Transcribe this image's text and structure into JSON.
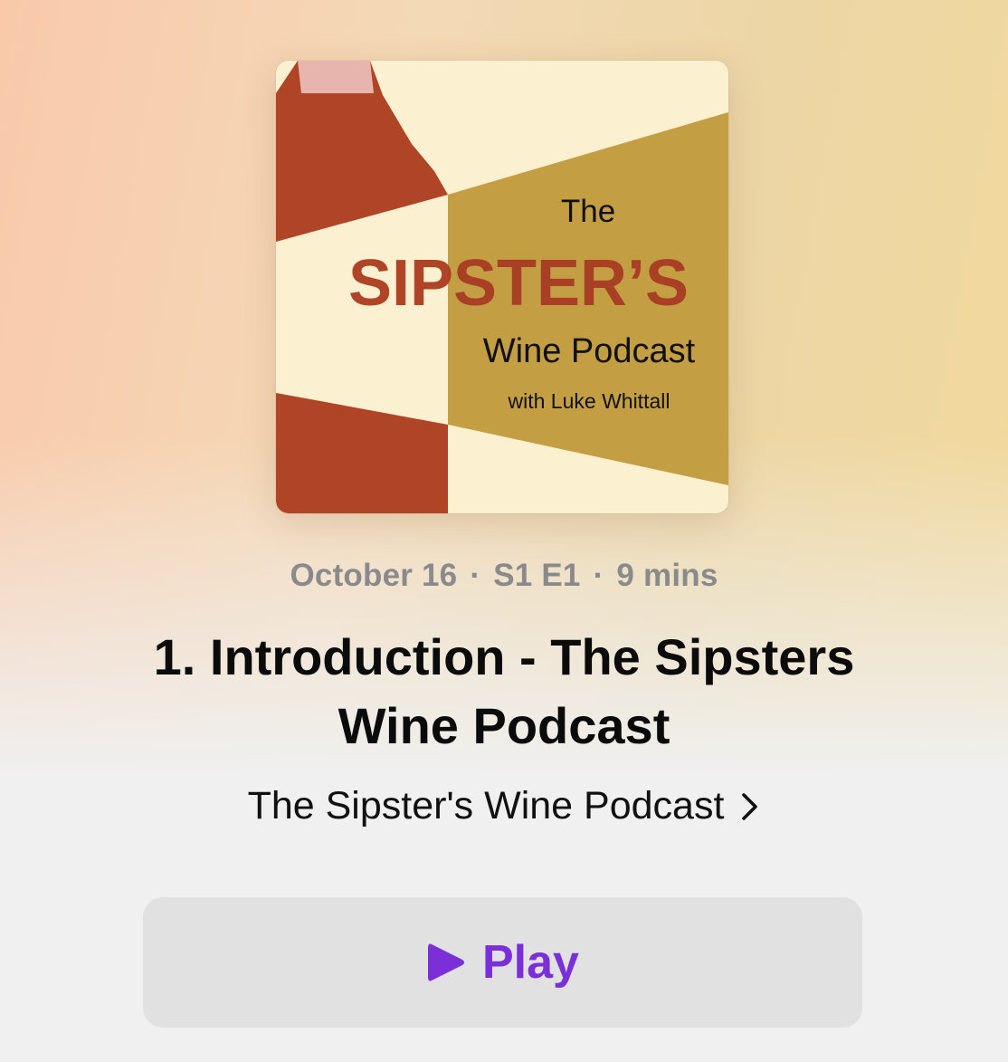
{
  "artwork": {
    "line1": "The",
    "line2": "SIPSTER’S",
    "line3": "Wine Podcast",
    "line4": "with Luke Whittall",
    "colors": {
      "cream": "#fbf0cf",
      "wine": "#b04427",
      "gold": "#c49e42",
      "neck": "#e8b5ae"
    }
  },
  "episode": {
    "date": "October 16",
    "season_episode": "S1 E1",
    "duration": "9 mins",
    "separator": "·",
    "title": "1. Introduction - The Sipsters Wine Podcast"
  },
  "show": {
    "name": "The Sipster's Wine Podcast",
    "chevron_icon": "chevron-right-icon"
  },
  "play": {
    "label": "Play",
    "icon": "play-icon",
    "accent": "#7a2fd8"
  }
}
